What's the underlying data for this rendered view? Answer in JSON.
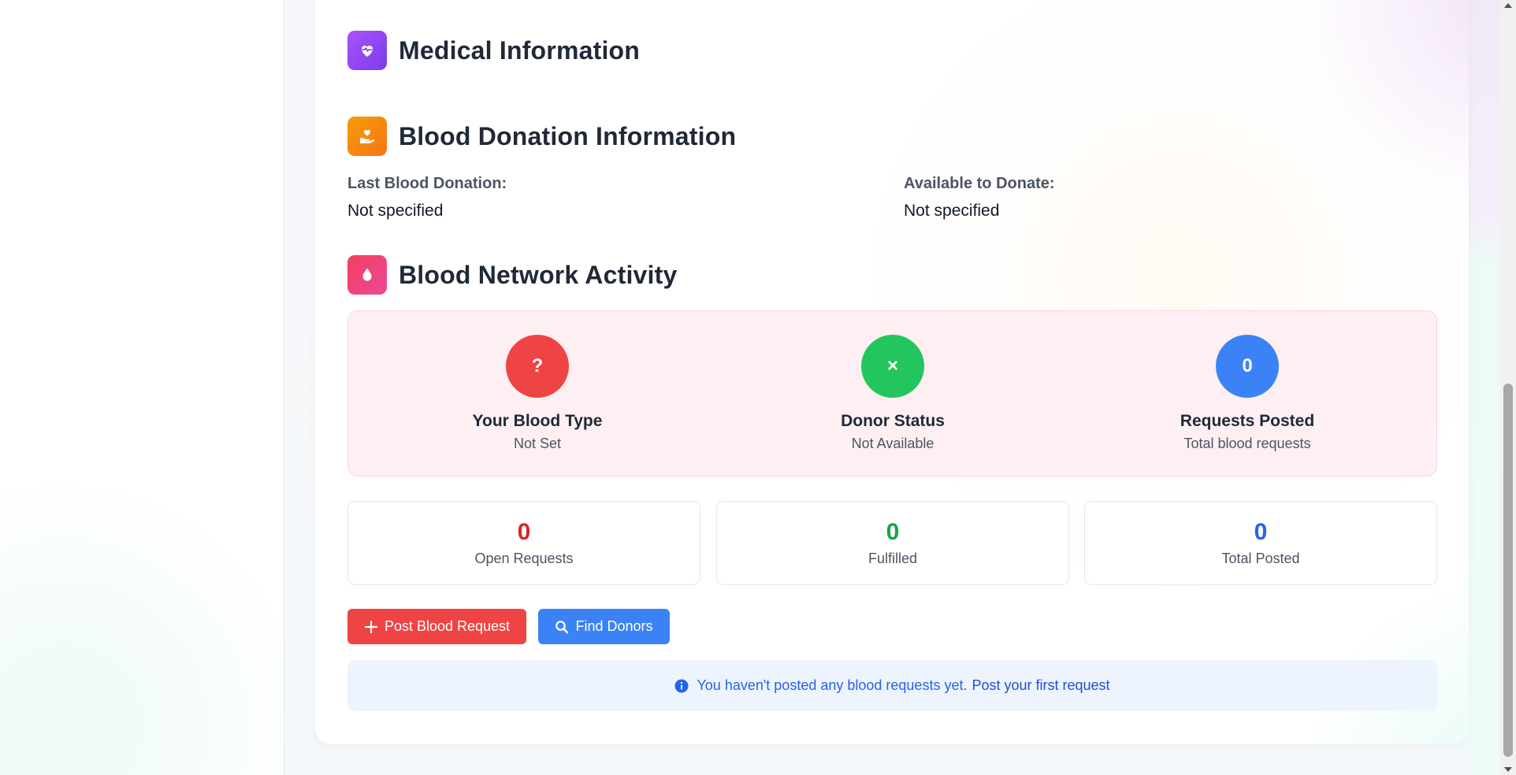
{
  "sections": {
    "medical": {
      "title": "Medical Information",
      "icon": "heart-pulse-icon"
    },
    "donation": {
      "title": "Blood Donation Information",
      "icon": "hand-heart-icon",
      "last_donation_label": "Last Blood Donation:",
      "last_donation_value": "Not specified",
      "available_label": "Available to Donate:",
      "available_value": "Not specified"
    },
    "activity": {
      "title": "Blood Network Activity",
      "icon": "blood-drop-icon",
      "stats": [
        {
          "circle": "?",
          "title": "Your Blood Type",
          "sub": "Not Set",
          "color": "#ef4444"
        },
        {
          "circle": "×",
          "title": "Donor Status",
          "sub": "Not Available",
          "color": "#22c55e"
        },
        {
          "circle": "0",
          "title": "Requests Posted",
          "sub": "Total blood requests",
          "color": "#3b82f6"
        }
      ],
      "counts": [
        {
          "value": "0",
          "label": "Open Requests",
          "color": "#dc2626"
        },
        {
          "value": "0",
          "label": "Fulfilled",
          "color": "#16a34a"
        },
        {
          "value": "0",
          "label": "Total Posted",
          "color": "#2563eb"
        }
      ]
    }
  },
  "actions": {
    "post_request_label": "Post Blood Request",
    "find_donors_label": "Find Donors"
  },
  "notice": {
    "text": "You haven't posted any blood requests yet.",
    "link": "Post your first request"
  }
}
